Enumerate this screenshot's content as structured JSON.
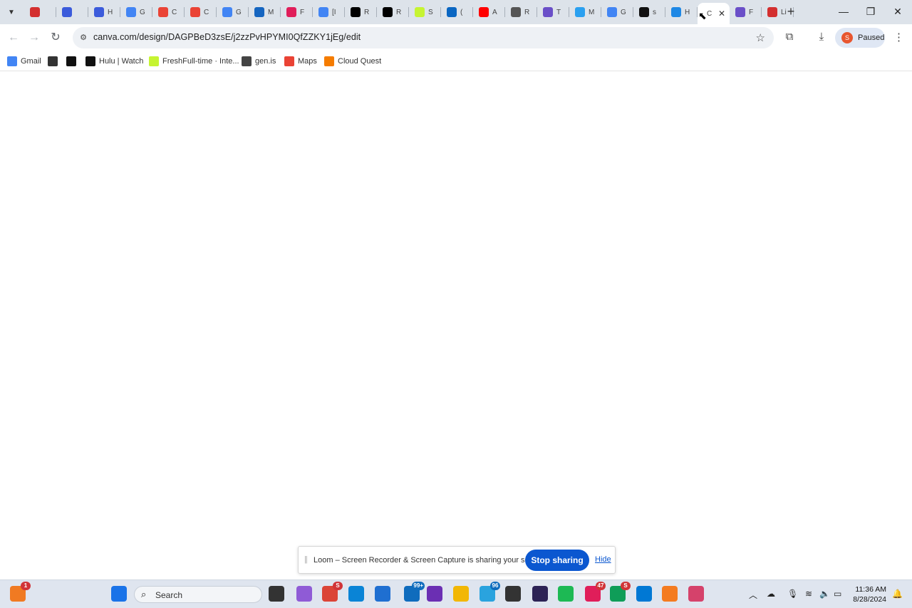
{
  "browser": {
    "tabs": [
      {
        "title": "",
        "icon": "record-icon",
        "color": "#d32f2f"
      },
      {
        "title": "",
        "icon": "blue-app-icon",
        "color": "#3b5bdb"
      },
      {
        "title": "H",
        "icon": "blue-app-icon",
        "color": "#3b5bdb"
      },
      {
        "title": "G",
        "icon": "google-icon",
        "color": "#4285f4"
      },
      {
        "title": "C",
        "icon": "gmail-icon",
        "color": "#ea4335"
      },
      {
        "title": "C",
        "icon": "gmail-icon",
        "color": "#ea4335"
      },
      {
        "title": "G",
        "icon": "google-icon",
        "color": "#4285f4"
      },
      {
        "title": "M",
        "icon": "diamond-icon",
        "color": "#1565c0"
      },
      {
        "title": "F",
        "icon": "slack-icon",
        "color": "#e01e5a"
      },
      {
        "title": "[I",
        "icon": "docs-icon",
        "color": "#4285f4"
      },
      {
        "title": "R",
        "icon": "x-icon",
        "color": "#000000"
      },
      {
        "title": "R",
        "icon": "x-icon",
        "color": "#000000"
      },
      {
        "title": "S",
        "icon": "freshfull-icon",
        "color": "#c6f432"
      },
      {
        "title": "(",
        "icon": "linkedin-icon",
        "color": "#0a66c2"
      },
      {
        "title": "A",
        "icon": "youtube-icon",
        "color": "#ff0000"
      },
      {
        "title": "R",
        "icon": "openai-icon",
        "color": "#555555"
      },
      {
        "title": "T",
        "icon": "gear-purple-icon",
        "color": "#6a4fc8"
      },
      {
        "title": "M",
        "icon": "copilot-icon",
        "color": "#2aa0f0"
      },
      {
        "title": "G",
        "icon": "google-icon",
        "color": "#4285f4"
      },
      {
        "title": "s",
        "icon": "github-icon",
        "color": "#111111"
      },
      {
        "title": "H",
        "icon": "canva-icon",
        "color": "#1e88e5"
      },
      {
        "title": "C",
        "icon": "",
        "color": "#ffffff",
        "active": true
      },
      {
        "title": "F",
        "icon": "gear-purple-icon",
        "color": "#6a4fc8"
      },
      {
        "title": "Li",
        "icon": "record-icon",
        "color": "#d32f2f"
      }
    ],
    "url": "canva.com/design/DAGPBeD3zsE/j2zzPvHPYMI0QfZZKY1jEg/edit",
    "profile_status": "Paused",
    "profile_initial": "S",
    "bookmarks": [
      {
        "label": "Gmail",
        "icon": "google-icon",
        "color": "#4285f4"
      },
      {
        "label": "",
        "icon": "globe-icon",
        "color": "#333333"
      },
      {
        "label": "",
        "icon": "h-icon",
        "color": "#111111"
      },
      {
        "label": "Hulu | Watch",
        "icon": "h-icon",
        "color": "#111111"
      },
      {
        "label": "FreshFull-time · Inte...",
        "icon": "freshfull-icon",
        "color": "#c6f432"
      },
      {
        "label": "gen.is",
        "icon": "folder-icon",
        "color": "#444444"
      },
      {
        "label": "Maps",
        "icon": "maps-icon",
        "color": "#ea4335"
      },
      {
        "label": "Cloud Quest",
        "icon": "cloud-quest-icon",
        "color": "#f57c00"
      }
    ]
  },
  "loom": {
    "message": "Loom – Screen Recorder & Screen Capture is sharing your screen.",
    "stop_label": "Stop sharing",
    "hide_label": "Hide"
  },
  "taskbar": {
    "search_label": "Search",
    "apps": [
      {
        "name": "widgets-icon",
        "color": "#f07a22",
        "badge": "1"
      },
      {
        "name": "windows-start-icon",
        "color": "#1a73e8",
        "badge": ""
      },
      {
        "name": "file-explorer-icon",
        "color": "#333333",
        "badge": ""
      },
      {
        "name": "copilot-icon",
        "color": "#8f5bd6",
        "badge": ""
      },
      {
        "name": "chrome-icon",
        "color": "#db4437",
        "badge": "S"
      },
      {
        "name": "edge-icon",
        "color": "#0a84d6",
        "badge": ""
      },
      {
        "name": "store-icon",
        "color": "#1f6fd1",
        "badge": ""
      },
      {
        "name": "mail-icon",
        "color": "#0f6cbd",
        "badge": "99+"
      },
      {
        "name": "obs-icon",
        "color": "#6b2fb3",
        "badge": ""
      },
      {
        "name": "folder-icon",
        "color": "#f2b705",
        "badge": ""
      },
      {
        "name": "telegram-icon",
        "color": "#2aa3de",
        "badge": "96"
      },
      {
        "name": "notes-icon",
        "color": "#333333",
        "badge": ""
      },
      {
        "name": "eclipse-icon",
        "color": "#2c2255",
        "badge": ""
      },
      {
        "name": "spotify-icon",
        "color": "#1db954",
        "badge": ""
      },
      {
        "name": "slack-icon",
        "color": "#e01e5a",
        "badge": "47"
      },
      {
        "name": "chrome-profile-icon",
        "color": "#0f9d58",
        "badge": "S"
      },
      {
        "name": "vscode-icon",
        "color": "#0078d4",
        "badge": ""
      },
      {
        "name": "pencil-icon",
        "color": "#f47b20",
        "badge": ""
      },
      {
        "name": "snipping-tool-icon",
        "color": "#d5426b",
        "badge": ""
      }
    ],
    "time": "11:36 AM",
    "date": "8/28/2024"
  }
}
